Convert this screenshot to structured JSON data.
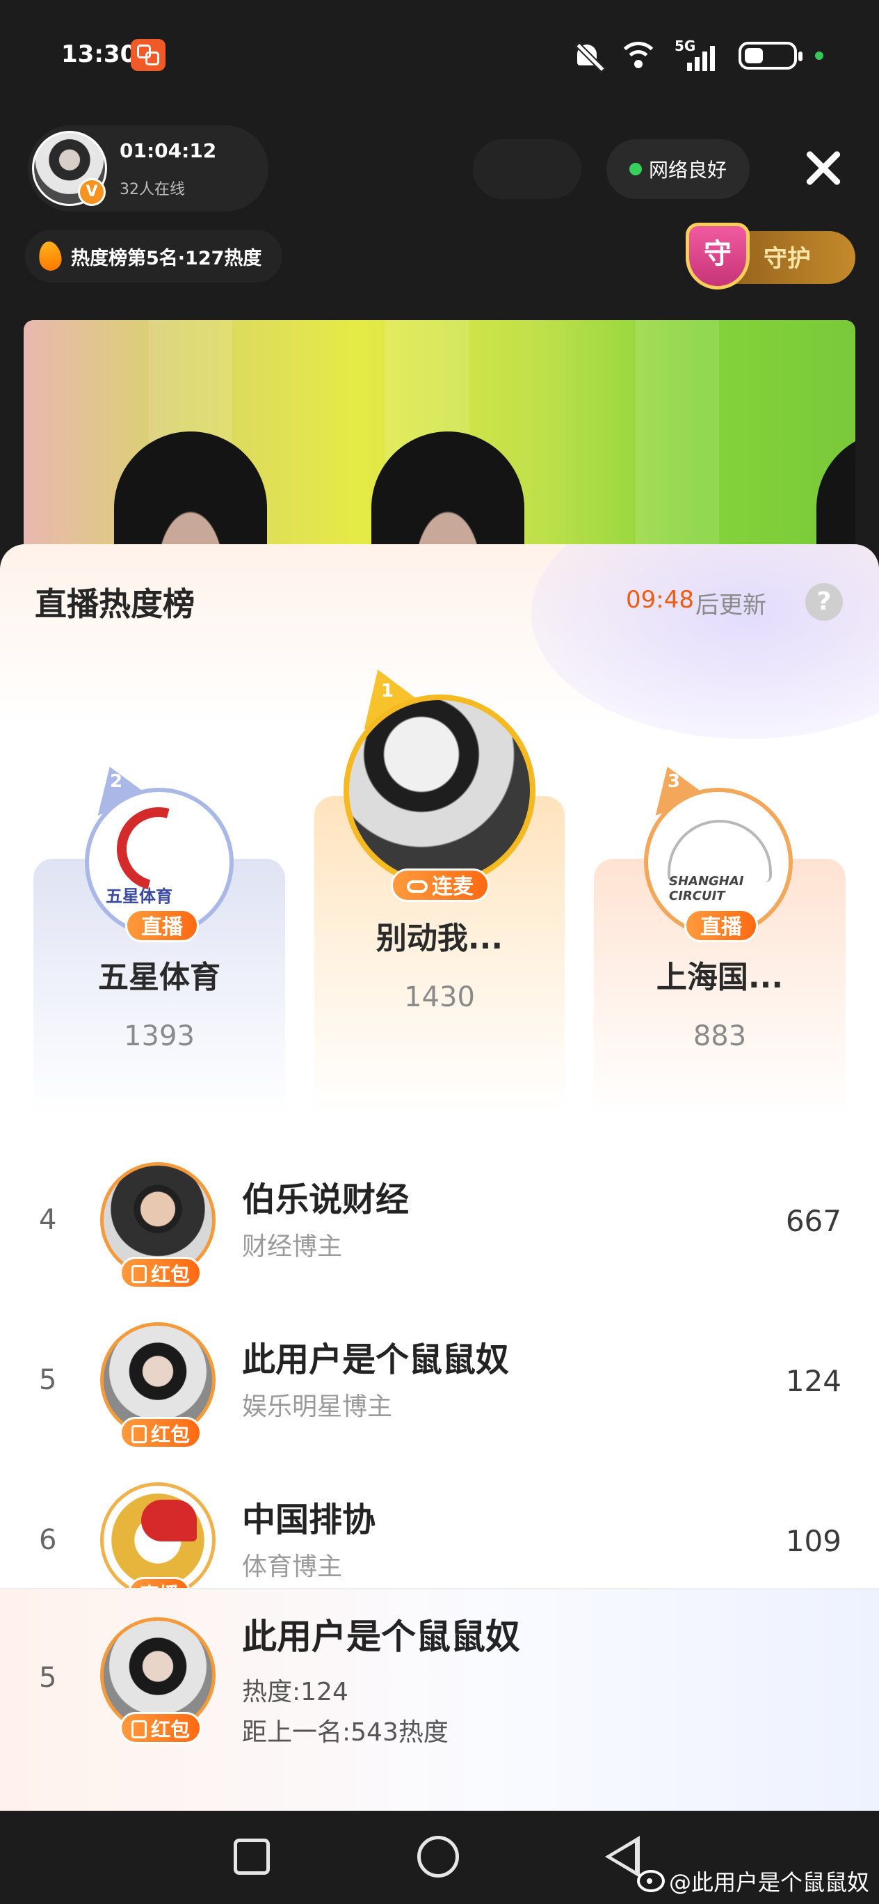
{
  "status_bar": {
    "time": "13:30",
    "network_type": "5G",
    "sim_slot": "6"
  },
  "live_header": {
    "duration": "01:04:12",
    "online": "32人在线",
    "verified_mark": "V",
    "network_status": "网络良好",
    "rank_info": "热度榜第5名·127热度",
    "guard_icon_text": "守",
    "guard_label": "守护"
  },
  "panel": {
    "title": "直播热度榜",
    "update_timer": "09:48",
    "update_suffix": "后更新",
    "help": "?"
  },
  "podium": [
    {
      "rank": "1",
      "name": "别动我...",
      "score": "1430",
      "tag": "连麦",
      "accent": "#f5b921"
    },
    {
      "rank": "2",
      "name": "五星体育",
      "score": "1393",
      "tag": "直播",
      "logo_text": "五星体育",
      "accent": "#a9b8e6"
    },
    {
      "rank": "3",
      "name": "上海国...",
      "score": "883",
      "tag": "直播",
      "logo_text": "SHANGHAI CIRCUIT",
      "accent": "#f3a75a"
    }
  ],
  "list": [
    {
      "rank": "4",
      "name": "伯乐说财经",
      "subtitle": "财经博主",
      "score": "667",
      "tag": "红包"
    },
    {
      "rank": "5",
      "name": "此用户是个鼠鼠奴",
      "subtitle": "娱乐明星博主",
      "score": "124",
      "tag": "红包"
    },
    {
      "rank": "6",
      "name": "中国排协",
      "subtitle": "体育博主",
      "score": "109",
      "tag": "直播"
    }
  ],
  "self": {
    "rank": "5",
    "name": "此用户是个鼠鼠奴",
    "heat": "热度:124",
    "gap": "距上一名:543热度",
    "tag": "红包"
  },
  "watermark": "@此用户是个鼠鼠奴",
  "colors": {
    "accent_orange": "#ff6a12",
    "timer_orange": "#ef5d12",
    "network_green": "#37d05c"
  }
}
